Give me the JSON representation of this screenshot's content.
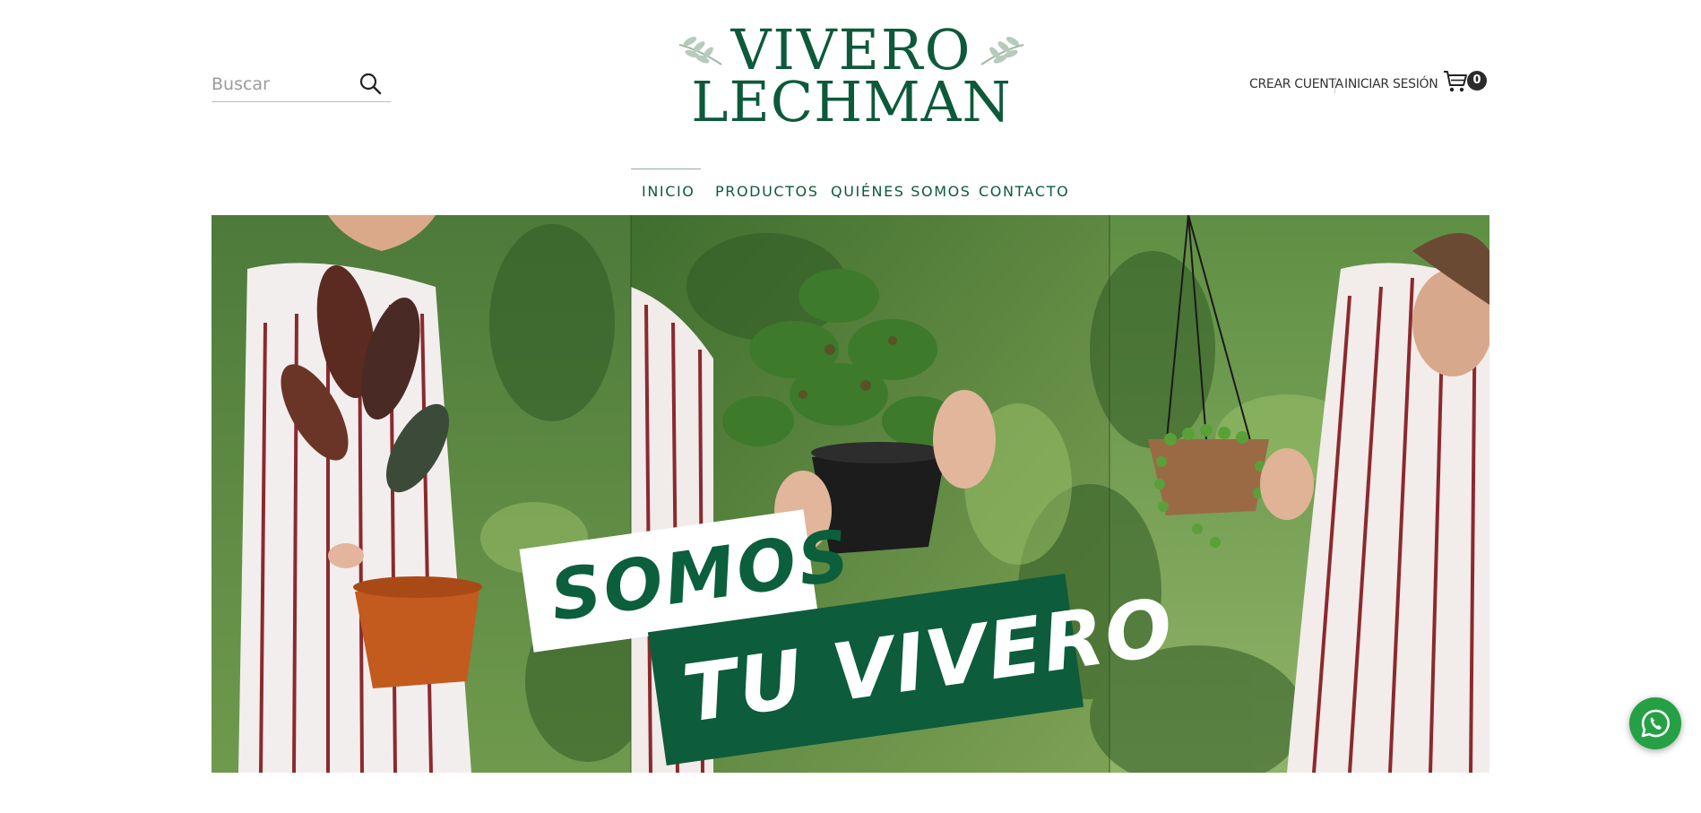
{
  "search": {
    "placeholder": "Buscar"
  },
  "logo": {
    "line1": "VIVERO",
    "line2": "LECHMAN"
  },
  "account": {
    "create_label": "CREAR CUENTA",
    "login_label": "INICIAR SESIÓN"
  },
  "cart": {
    "count": "0"
  },
  "nav": {
    "items": [
      {
        "label": "INICIO",
        "active": true
      },
      {
        "label": "PRODUCTOS",
        "active": false
      },
      {
        "label": "QUIÉNES SOMOS",
        "active": false
      },
      {
        "label": "CONTACTO",
        "active": false
      }
    ]
  },
  "hero": {
    "banner_top": "SOMOS",
    "banner_bottom": "TU VIVERO"
  },
  "colors": {
    "brand_green": "#0d5a3a",
    "whatsapp_green": "#25a045"
  },
  "icons": {
    "search": "search-icon",
    "cart": "cart-icon",
    "whatsapp": "whatsapp-icon"
  }
}
